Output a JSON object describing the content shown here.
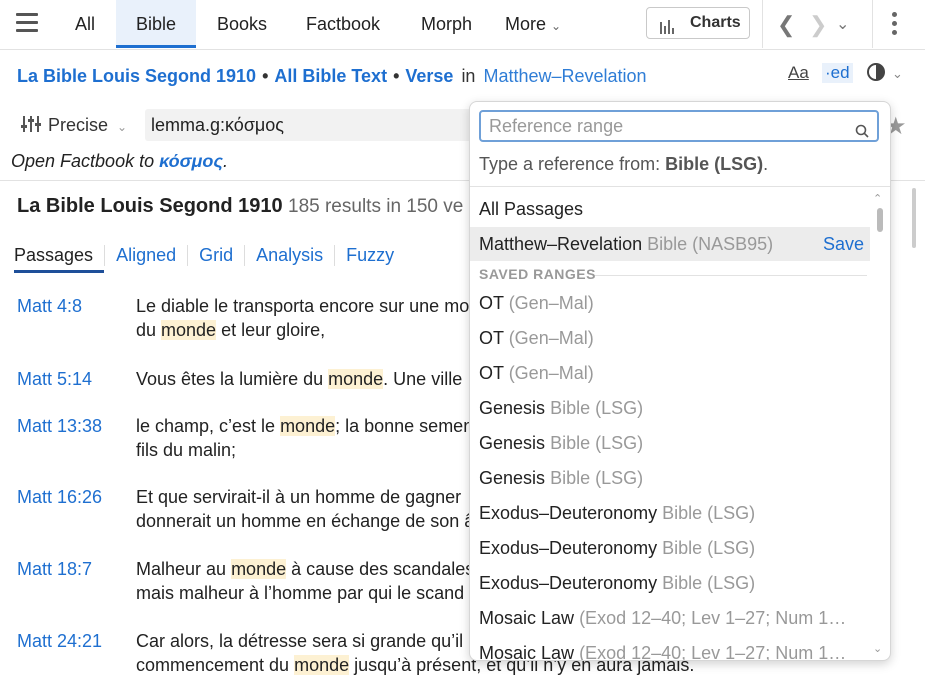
{
  "topnav": {
    "tabs": [
      {
        "label": "All"
      },
      {
        "label": "Bible"
      },
      {
        "label": "Books"
      },
      {
        "label": "Factbook"
      },
      {
        "label": "Morph"
      },
      {
        "label": "More"
      }
    ],
    "charts_label": "Charts"
  },
  "breadcrumb": {
    "bible": "La Bible Louis Segond 1910",
    "scope": "All Bible Text",
    "unit": "Verse",
    "in": "in",
    "range": "Matthew–Revelation",
    "view_icons": [
      "Aa",
      "·ed"
    ]
  },
  "search": {
    "mode": "Precise",
    "query": "lemma.g:κόσμος"
  },
  "factbook": {
    "prefix": "Open Factbook to ",
    "term": "κόσμος",
    "suffix": "."
  },
  "results": {
    "title": "La Bible Louis Segond 1910",
    "count": "185 results in 150 ve"
  },
  "subtabs": [
    "Passages",
    "Aligned",
    "Grid",
    "Analysis",
    "Fuzzy"
  ],
  "verses": [
    {
      "ref": "Matt 4:8",
      "l1": [
        "Le diable le transporta encore sur une mo"
      ],
      "l2": [
        "du ",
        "monde",
        " et leur gloire,"
      ]
    },
    {
      "ref": "Matt 5:14",
      "l1": [
        "Vous êtes la lumière du ",
        "monde",
        ". Une ville"
      ],
      "l2": []
    },
    {
      "ref": "Matt 13:38",
      "l1": [
        "le champ, c’est le ",
        "monde",
        "; la bonne semen"
      ],
      "l2": [
        "fils du malin;"
      ]
    },
    {
      "ref": "Matt 16:26",
      "l1": [
        "Et que servirait-il à un homme de gagner"
      ],
      "l2": [
        "donnerait un homme en échange de son â"
      ]
    },
    {
      "ref": "Matt 18:7",
      "l1": [
        "Malheur au ",
        "monde",
        " à cause des scandales"
      ],
      "l2": [
        "mais malheur à l’homme par qui le scand"
      ]
    },
    {
      "ref": "Matt 24:21",
      "l1": [
        "Car alors, la détresse sera si grande qu’il n"
      ],
      "l2": [
        "commencement du ",
        "monde",
        " jusqu’à présent, et qu’il n’y en aura jamais."
      ]
    }
  ],
  "dropdown": {
    "placeholder": "Reference range",
    "hint_prefix": "Type a reference from: ",
    "hint_bold": "Bible (LSG)",
    "hint_suffix": ".",
    "all_passages": "All Passages",
    "current": {
      "name": "Matthew–Revelation",
      "sub": "Bible (NASB95)",
      "action": "Save"
    },
    "saved_header": "SAVED RANGES",
    "saved": [
      {
        "name": "OT",
        "sub": "(Gen–Mal)"
      },
      {
        "name": "OT",
        "sub": "(Gen–Mal)"
      },
      {
        "name": "OT",
        "sub": "(Gen–Mal)"
      },
      {
        "name": "Genesis",
        "sub": "Bible (LSG)"
      },
      {
        "name": "Genesis",
        "sub": "Bible (LSG)"
      },
      {
        "name": "Genesis",
        "sub": "Bible (LSG)"
      },
      {
        "name": "Exodus–Deuteronomy",
        "sub": "Bible (LSG)"
      },
      {
        "name": "Exodus–Deuteronomy",
        "sub": "Bible (LSG)"
      },
      {
        "name": "Exodus–Deuteronomy",
        "sub": "Bible (LSG)"
      },
      {
        "name": "Mosaic Law",
        "sub": "(Exod 12–40; Lev 1–27; Num 1…"
      },
      {
        "name": "Mosaic Law",
        "sub": "(Exod 12–40; Lev 1–27; Num 1…"
      }
    ]
  },
  "colors": {
    "accent": "#1e6fd0",
    "highlight": "#fdf1d3"
  }
}
